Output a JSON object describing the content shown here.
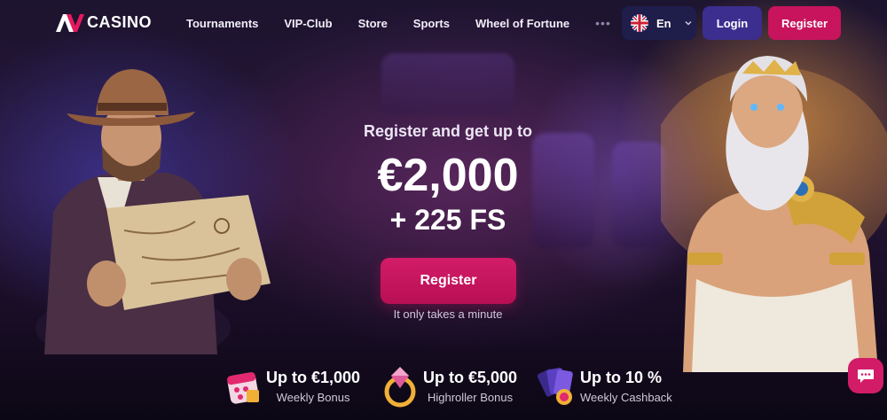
{
  "header": {
    "logo_text": "CASINO",
    "nav": [
      "Tournaments",
      "VIP-Club",
      "Store",
      "Sports",
      "Wheel of Fortune"
    ],
    "more_icon": "ellipsis-icon",
    "language": {
      "flag_icon": "uk-flag-icon",
      "label": "En"
    },
    "login_label": "Login",
    "register_label": "Register"
  },
  "hero": {
    "subtitle": "Register and get up to",
    "amount": "€2,000",
    "free_spins": "+ 225 FS",
    "register_label": "Register",
    "note": "It only takes a minute"
  },
  "bonuses": [
    {
      "icon": "calendar-gift-icon",
      "title": "Up to €1,000",
      "subtitle": "Weekly Bonus"
    },
    {
      "icon": "diamond-ring-icon",
      "title": "Up to €5,000",
      "subtitle": "Highroller Bonus"
    },
    {
      "icon": "cashback-cards-icon",
      "title": "Up to 10 %",
      "subtitle": "Weekly Cashback"
    }
  ],
  "chat": {
    "icon": "chat-bubble-icon"
  },
  "colors": {
    "accent_pink": "#c8145d",
    "login_purple": "#3b2e8f",
    "lang_bg": "#1f1d4a",
    "background": "#1d1430"
  }
}
